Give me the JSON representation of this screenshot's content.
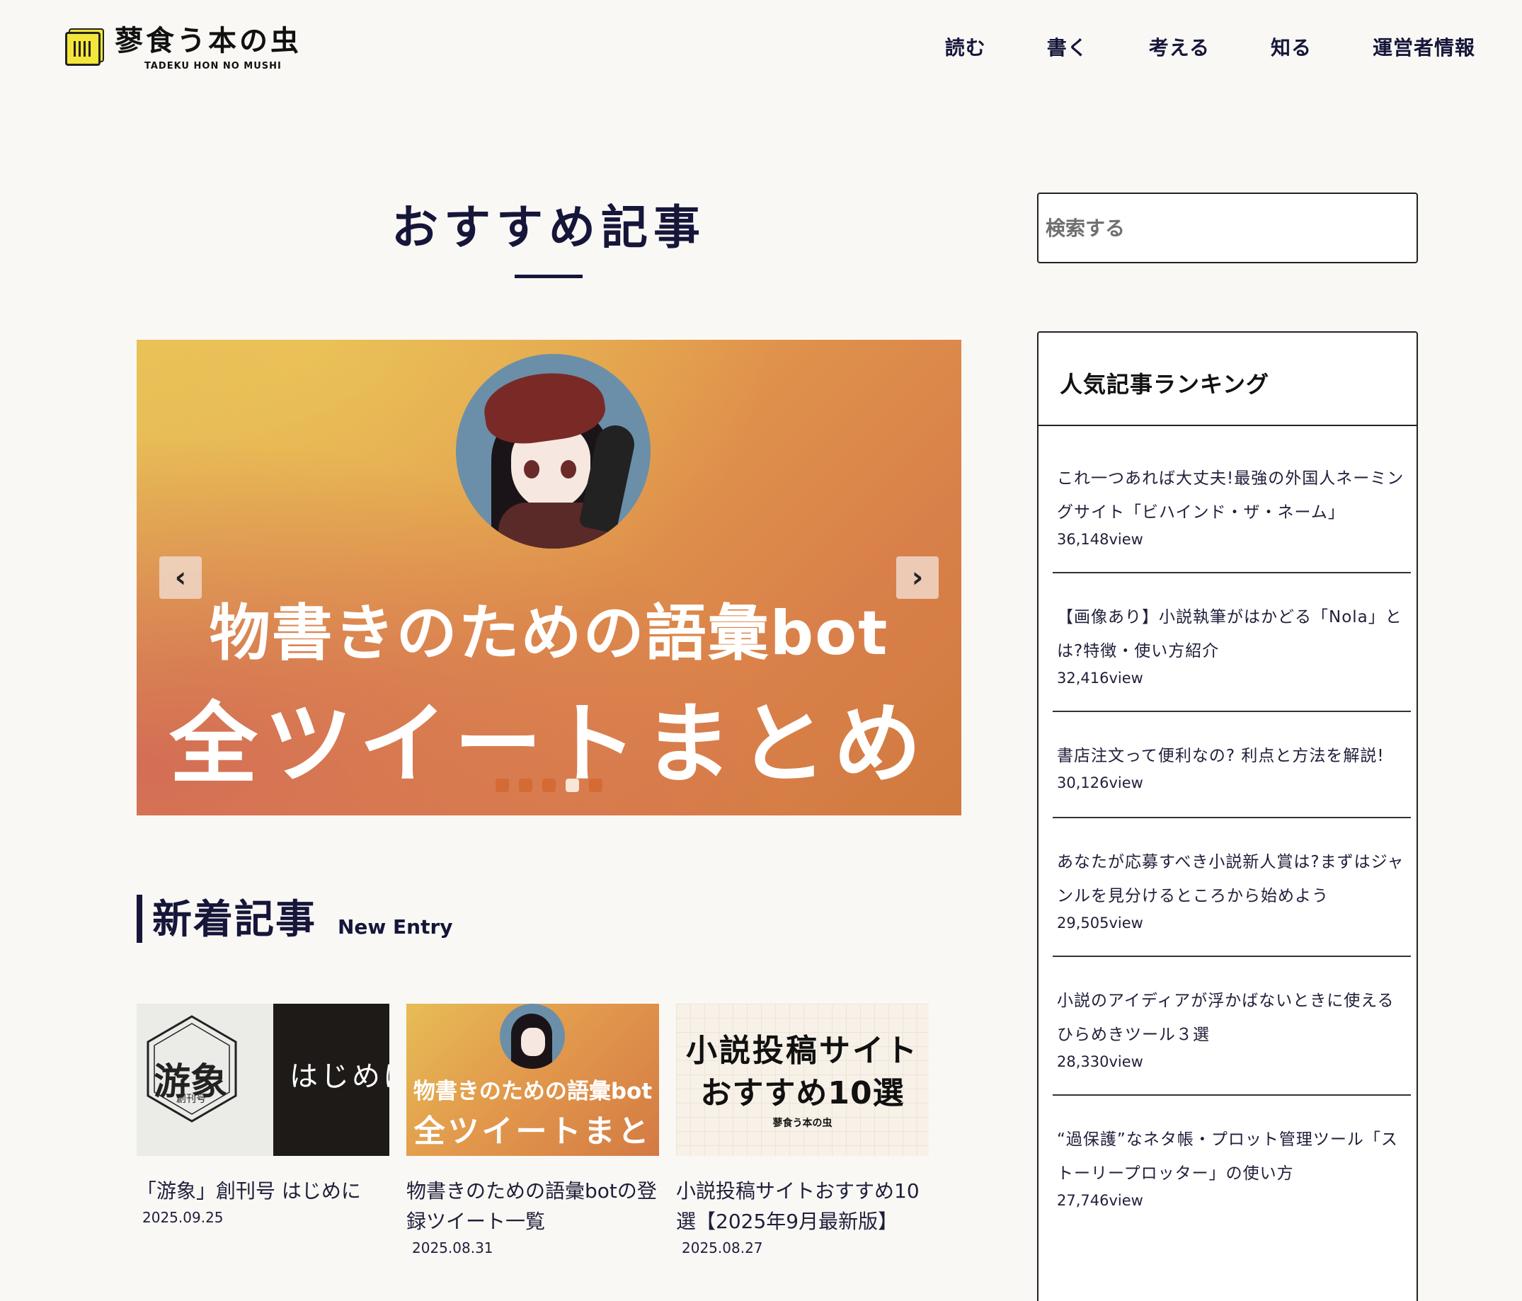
{
  "header": {
    "logo_jp": "蓼食う本の虫",
    "logo_en": "TADEKU HON NO MUSHI",
    "nav": [
      "読む",
      "書く",
      "考える",
      "知る",
      "運営者情報"
    ]
  },
  "featured": {
    "heading": "おすすめ記事",
    "slide": {
      "line1": "物書きのための語彙bot",
      "line2": "全ツイートまとめ",
      "prev_icon": "‹",
      "next_icon": "›",
      "dot_count": 5,
      "active_dot": 4
    }
  },
  "new_entry": {
    "heading_jp": "新着記事",
    "heading_en": "New Entry",
    "cards": [
      {
        "title": "「游象」創刊号 はじめに",
        "date": "2025.09.25",
        "thumb": {
          "brand": "游象",
          "issue": "創刊号",
          "text": "はじめに"
        }
      },
      {
        "title": "物書きのための語彙botの登録ツイート一覧",
        "date": "2025.08.31",
        "thumb": {
          "line1": "物書きのための語彙bot",
          "line2": "全ツイートまとめ"
        }
      },
      {
        "title": "小説投稿サイトおすすめ10選【2025年9月最新版】",
        "date": "2025.08.27",
        "thumb": {
          "line1": "小説投稿サイト",
          "line2": "おすすめ10選",
          "line3": "蓼食う本の虫"
        }
      }
    ]
  },
  "sidebar": {
    "search_placeholder": "検索する",
    "ranking_heading": "人気記事ランキング",
    "ranking": [
      {
        "title": "これ一つあれば大丈夫!最強の外国人ネーミングサイト「ビハインド・ザ・ネーム」",
        "views": "36,148view"
      },
      {
        "title": "【画像あり】小説執筆がはかどる「Nola」とは?特徴・使い方紹介",
        "views": "32,416view"
      },
      {
        "title": "書店注文って便利なの? 利点と方法を解説!",
        "views": "30,126view"
      },
      {
        "title": "あなたが応募すべき小説新人賞は?まずはジャンルを見分けるところから始めよう",
        "views": "29,505view"
      },
      {
        "title": "小説のアイディアが浮かばないときに使えるひらめきツール３選",
        "views": "28,330view"
      },
      {
        "title": "“過保護”なネタ帳・プロット管理ツール「ストーリープロッター」の使い方",
        "views": "27,746view"
      }
    ]
  },
  "colors": {
    "background": "#faf8f5",
    "text": "#16163a",
    "logo_yellow": "#f4e53a"
  }
}
